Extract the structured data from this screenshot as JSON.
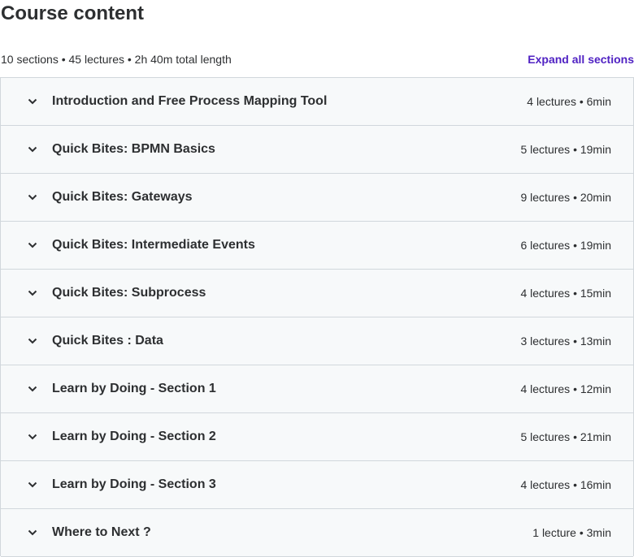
{
  "page": {
    "title": "Course content",
    "summary": "10 sections • 45 lectures • 2h 40m total length",
    "expand_label": "Expand all sections"
  },
  "icons": {
    "section_toggle": "chevron-down-icon"
  },
  "colors": {
    "accent": "#5022c3",
    "section_bg": "#f7f9fa",
    "border": "#d1d7dc",
    "text": "#2d2f31"
  },
  "sections": [
    {
      "title": "Introduction and Free Process Mapping Tool",
      "meta": "4 lectures • 6min"
    },
    {
      "title": "Quick Bites: BPMN Basics",
      "meta": "5 lectures • 19min"
    },
    {
      "title": "Quick Bites: Gateways",
      "meta": "9 lectures • 20min"
    },
    {
      "title": "Quick Bites: Intermediate Events",
      "meta": "6 lectures • 19min"
    },
    {
      "title": "Quick Bites: Subprocess",
      "meta": "4 lectures • 15min"
    },
    {
      "title": "Quick Bites : Data",
      "meta": "3 lectures • 13min"
    },
    {
      "title": "Learn by Doing - Section 1",
      "meta": "4 lectures • 12min"
    },
    {
      "title": "Learn by Doing - Section 2",
      "meta": "5 lectures • 21min"
    },
    {
      "title": "Learn by Doing - Section 3",
      "meta": "4 lectures • 16min"
    },
    {
      "title": "Where to Next ?",
      "meta": "1 lecture • 3min"
    }
  ]
}
